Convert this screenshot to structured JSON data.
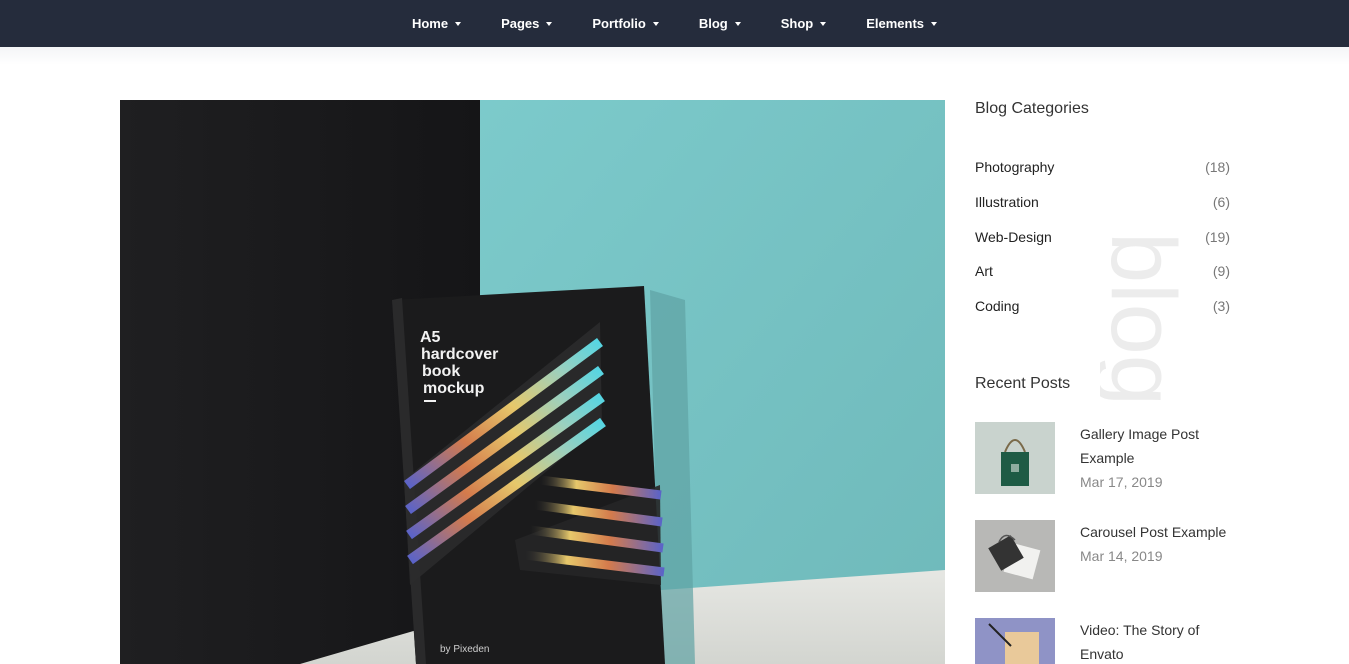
{
  "nav": {
    "items": [
      {
        "label": "Home"
      },
      {
        "label": "Pages"
      },
      {
        "label": "Portfolio"
      },
      {
        "label": "Blog"
      },
      {
        "label": "Shop"
      },
      {
        "label": "Elements"
      }
    ]
  },
  "hero": {
    "book_title_lines": [
      "A5",
      "hardcover",
      "book",
      "mockup"
    ],
    "book_byline": "by Pixeden"
  },
  "sidebar": {
    "categories_title": "Blog Categories",
    "categories": [
      {
        "name": "Photography",
        "count": "(18)"
      },
      {
        "name": "Illustration",
        "count": "(6)"
      },
      {
        "name": "Web-Design",
        "count": "(19)"
      },
      {
        "name": "Art",
        "count": "(9)"
      },
      {
        "name": "Coding",
        "count": "(3)"
      }
    ],
    "watermark_text": "blog",
    "recent_title": "Recent Posts",
    "posts": [
      {
        "title": "Gallery Image Post Example",
        "date": "Mar 17, 2019"
      },
      {
        "title": "Carousel Post Example",
        "date": "Mar 14, 2019"
      },
      {
        "title": "Video: The Story of Envato",
        "date": ""
      }
    ]
  },
  "colors": {
    "nav_bg": "#252c3c",
    "teal_wall": "#79c4c5",
    "dark_wall": "#1c1c1e"
  }
}
